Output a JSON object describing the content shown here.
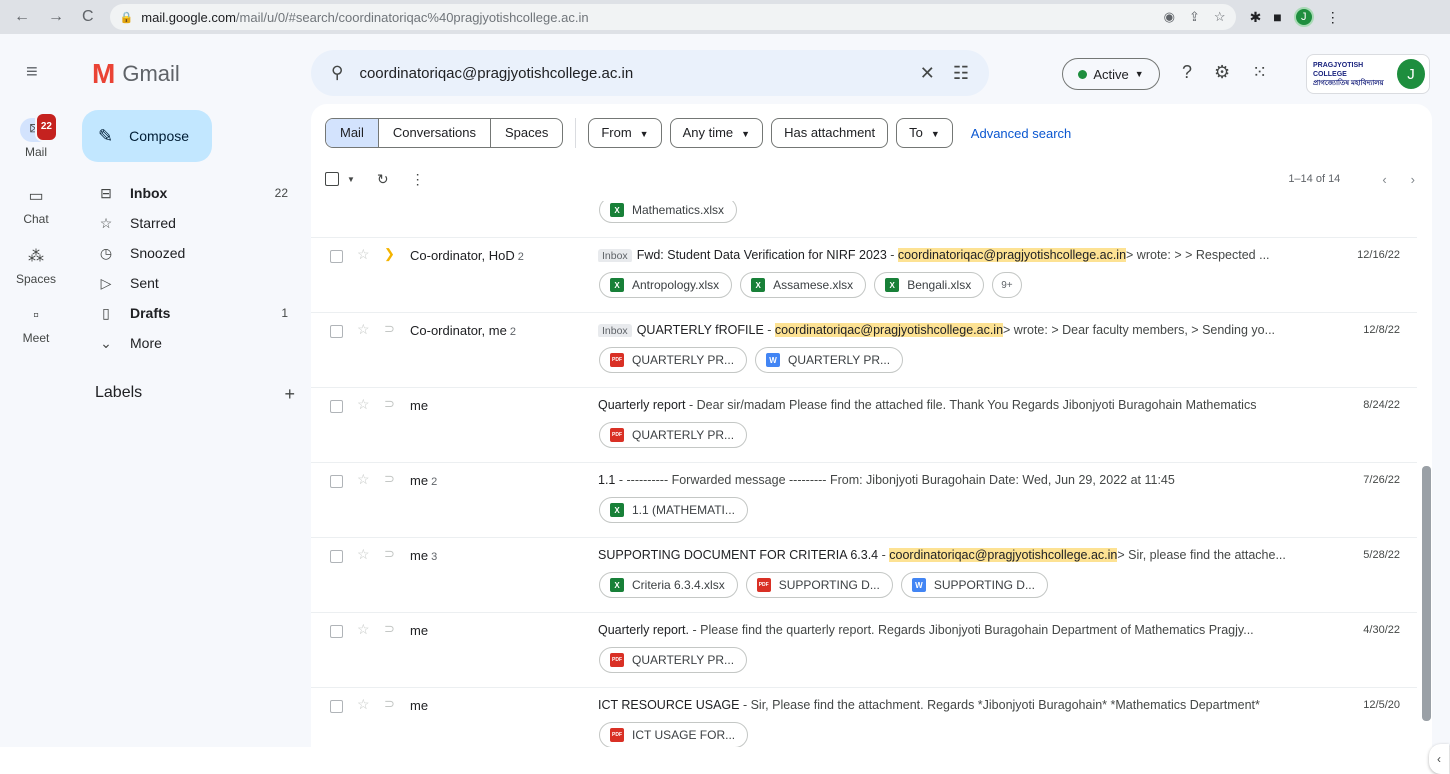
{
  "browser": {
    "url_host": "mail.google.com",
    "url_rest": "/mail/u/0/#search/coordinatoriqac%40pragjyotishcollege.ac.in",
    "profile_initial": "J"
  },
  "rail": {
    "mail_label": "Mail",
    "mail_badge": "22",
    "chat_label": "Chat",
    "spaces_label": "Spaces",
    "meet_label": "Meet"
  },
  "app": {
    "name": "Gmail"
  },
  "compose_label": "Compose",
  "nav": [
    {
      "label": "Inbox",
      "count": "22",
      "icon": "inbox-icon"
    },
    {
      "label": "Starred",
      "count": "",
      "icon": "star-icon"
    },
    {
      "label": "Snoozed",
      "count": "",
      "icon": "clock-icon"
    },
    {
      "label": "Sent",
      "count": "",
      "icon": "send-icon"
    },
    {
      "label": "Drafts",
      "count": "1",
      "icon": "draft-icon"
    },
    {
      "label": "More",
      "count": "",
      "icon": "chevron-down-icon"
    }
  ],
  "labels_heading": "Labels",
  "search": {
    "query": "coordinatoriqac@pragjyotishcollege.ac.in"
  },
  "status": {
    "label": "Active",
    "color": "#1e8e3e"
  },
  "account": {
    "avatar_initial": "J",
    "college_line1": "PRAGJYOTISH COLLEGE",
    "college_line2": "প্ৰাগজ্যোতিষ মহাবিদ্যালয়"
  },
  "filters": {
    "tabs": [
      "Mail",
      "Conversations",
      "Spaces"
    ],
    "selected_tab": "Mail",
    "chips": [
      "From",
      "Any time",
      "Has attachment",
      "To"
    ],
    "advanced": "Advanced search"
  },
  "pagination": "1–14 of 14",
  "highlight": "coordinatoriqac@pragjyotishcollege.ac.in",
  "emails": [
    {
      "sender": "",
      "count": "",
      "important": false,
      "tag": "",
      "subject": "",
      "pre": "",
      "post": "",
      "date": "",
      "attachments": [
        {
          "type": "xls",
          "icon_text": "X",
          "name": "Mathematics.xlsx"
        }
      ]
    },
    {
      "sender": "Co-ordinator, HoD",
      "count": "2",
      "important": true,
      "tag": "Inbox",
      "subject": "Fwd: Student Data Verification for NIRF 2023",
      "pre": " - ",
      "post": "> wrote: > > Respected ...",
      "hl": "coordinatoriqac@pragjyotishcollege.ac.in",
      "date": "12/16/22",
      "attachments": [
        {
          "type": "xls",
          "icon_text": "X",
          "name": "Antropology.xlsx"
        },
        {
          "type": "xls",
          "icon_text": "X",
          "name": "Assamese.xlsx"
        },
        {
          "type": "xls",
          "icon_text": "X",
          "name": "Bengali.xlsx"
        }
      ],
      "more": "9+"
    },
    {
      "sender": "Co-ordinator, me",
      "count": "2",
      "important": false,
      "tag": "Inbox",
      "subject": "QUARTERLY fROFILE",
      "pre": " - ",
      "post": "> wrote: > Dear faculty members, > Sending yo...",
      "hl": "coordinatoriqac@pragjyotishcollege.ac.in",
      "date": "12/8/22",
      "attachments": [
        {
          "type": "pdf",
          "icon_text": "PDF",
          "name": "QUARTERLY PR..."
        },
        {
          "type": "doc",
          "icon_text": "W",
          "name": "QUARTERLY PR..."
        }
      ]
    },
    {
      "sender": "me",
      "count": "",
      "important": false,
      "tag": "",
      "subject": "Quarterly report",
      "pre": " - Dear sir/madam Please find the attached file. Thank You Regards Jibonjyoti Buragohain Mathematics",
      "post": "",
      "hl": "",
      "date": "8/24/22",
      "attachments": [
        {
          "type": "pdf",
          "icon_text": "PDF",
          "name": "QUARTERLY PR..."
        }
      ]
    },
    {
      "sender": "me",
      "count": "2",
      "important": false,
      "tag": "",
      "subject": "1.1",
      "pre": " - ---------- Forwarded message --------- From: Jibonjyoti Buragohain Date: Wed, Jun 29, 2022 at 11:45",
      "post": "",
      "hl": "",
      "date": "7/26/22",
      "attachments": [
        {
          "type": "xls",
          "icon_text": "X",
          "name": "1.1 (MATHEMATI..."
        }
      ]
    },
    {
      "sender": "me",
      "count": "3",
      "important": false,
      "tag": "",
      "subject": "SUPPORTING DOCUMENT FOR CRITERIA 6.3.4",
      "pre": " - ",
      "post": "> Sir, please find the attache...",
      "hl": "coordinatoriqac@pragjyotishcollege.ac.in",
      "date": "5/28/22",
      "attachments": [
        {
          "type": "xls",
          "icon_text": "X",
          "name": "Criteria 6.3.4.xlsx"
        },
        {
          "type": "pdf",
          "icon_text": "PDF",
          "name": "SUPPORTING D..."
        },
        {
          "type": "doc",
          "icon_text": "W",
          "name": "SUPPORTING D..."
        }
      ]
    },
    {
      "sender": "me",
      "count": "",
      "important": false,
      "tag": "",
      "subject": "Quarterly report.",
      "pre": " - Please find the quarterly report. Regards Jibonjyoti Buragohain Department of Mathematics Pragjy...",
      "post": "",
      "hl": "",
      "date": "4/30/22",
      "attachments": [
        {
          "type": "pdf",
          "icon_text": "PDF",
          "name": "QUARTERLY PR..."
        }
      ]
    },
    {
      "sender": "me",
      "count": "",
      "important": false,
      "tag": "",
      "subject": "ICT RESOURCE USAGE",
      "pre": " - Sir, Please find the attachment. Regards *Jibonjyoti Buragohain* *Mathematics Department*",
      "post": "",
      "hl": "",
      "date": "12/5/20",
      "attachments": [
        {
          "type": "pdf",
          "icon_text": "PDF",
          "name": "ICT USAGE FOR..."
        }
      ]
    }
  ]
}
